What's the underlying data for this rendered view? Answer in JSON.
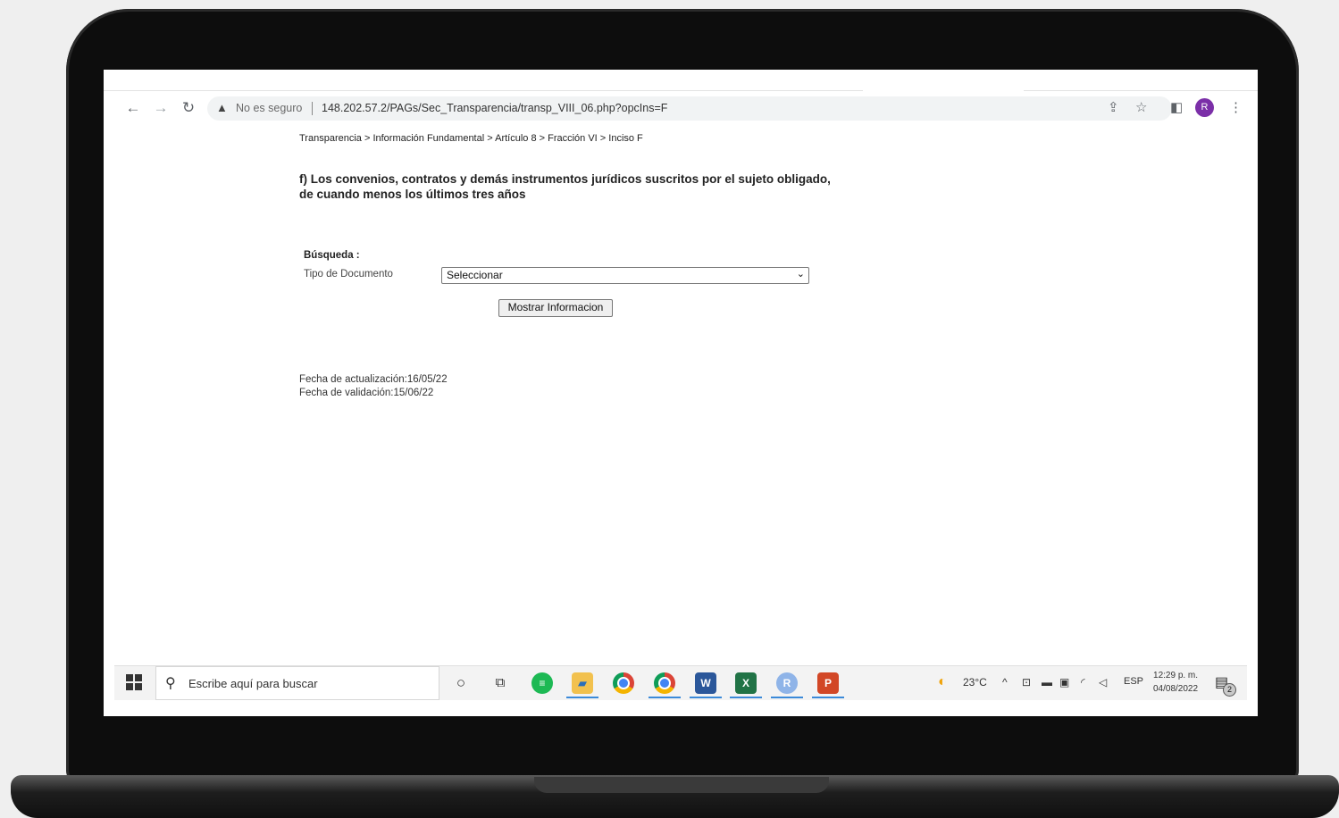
{
  "browser": {
    "nav": {
      "back_icon": "arrow-left-icon",
      "forward_icon": "arrow-right-icon",
      "reload_icon": "reload-icon"
    },
    "omnibox": {
      "security_icon": "warning-icon",
      "security_text": "No es seguro",
      "url": "148.202.57.2/PAGs/Sec_Transparencia/transp_VIII_06.php?opcIns=F"
    },
    "toolbar_icons": [
      "share-icon",
      "star-icon",
      "side-panel-icon",
      "menu-dots-icon"
    ],
    "profile_initial": "R",
    "profile_color": "#7b2fa8"
  },
  "page": {
    "breadcrumb": "Transparencia > Información Fundamental > Artículo 8 > Fracción VI > Inciso F",
    "heading": "f) Los convenios, contratos y demás instrumentos jurídicos suscritos por el sujeto obligado, de cuando menos los últimos tres años",
    "search": {
      "title": "Búsqueda :",
      "doc_type_label": "Tipo de Documento",
      "doc_type_selected": "Seleccionar",
      "show_button": "Mostrar Informacion"
    },
    "dates": {
      "updated": "Fecha de actualización:16/05/22",
      "validated": "Fecha de validación:15/06/22"
    }
  },
  "taskbar": {
    "search_placeholder": "Escribe aquí para buscar",
    "apps": [
      "cortana-icon",
      "task-view-icon",
      "spotify-icon",
      "file-explorer-icon",
      "chrome-icon",
      "chrome-icon",
      "word-icon",
      "excel-icon",
      "app-r-icon",
      "powerpoint-icon"
    ],
    "weather": "23°C",
    "language": "ESP",
    "time": "12:29 p. m.",
    "date": "04/08/2022",
    "notification_count": "2",
    "colors": {
      "spotify": "#1db954",
      "chrome": "#db4437",
      "word": "#2b579a",
      "excel": "#217346",
      "powerpoint": "#d24726",
      "accent": "#3b8ad9"
    }
  }
}
